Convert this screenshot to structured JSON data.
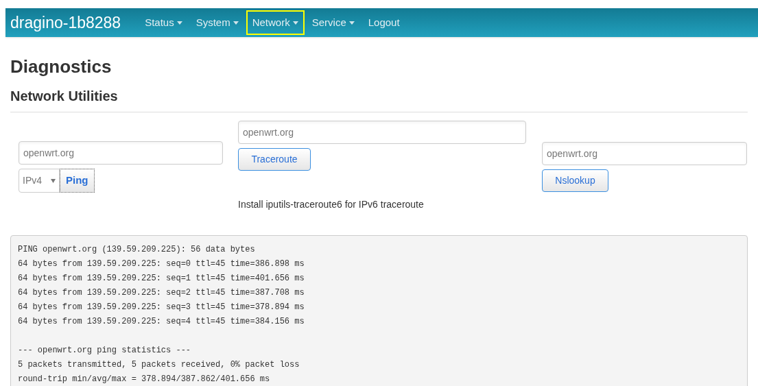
{
  "navbar": {
    "brand": "dragino-1b8288",
    "items": [
      {
        "label": "Status",
        "dropdown": true,
        "selected": false
      },
      {
        "label": "System",
        "dropdown": true,
        "selected": false
      },
      {
        "label": "Network",
        "dropdown": true,
        "selected": true
      },
      {
        "label": "Service",
        "dropdown": true,
        "selected": false
      },
      {
        "label": "Logout",
        "dropdown": false,
        "selected": false
      }
    ]
  },
  "page_title": "Diagnostics",
  "section_title": "Network Utilities",
  "ping": {
    "value": "openwrt.org",
    "protocol": "IPv4",
    "button": "Ping",
    "focused": true
  },
  "traceroute": {
    "value": "openwrt.org",
    "button": "Traceroute",
    "note": "Install iputils-traceroute6 for IPv6 traceroute"
  },
  "nslookup": {
    "value": "openwrt.org",
    "button": "Nslookup"
  },
  "output": {
    "blocks": [
      {
        "lines": [
          "PING openwrt.org (139.59.209.225): 56 data bytes",
          "64 bytes from 139.59.209.225: seq=0 ttl=45 time=386.898 ms",
          "64 bytes from 139.59.209.225: seq=1 ttl=45 time=401.656 ms",
          "64 bytes from 139.59.209.225: seq=2 ttl=45 time=387.708 ms",
          "64 bytes from 139.59.209.225: seq=3 ttl=45 time=378.894 ms",
          "64 bytes from 139.59.209.225: seq=4 ttl=45 time=384.156 ms"
        ]
      },
      {
        "lines": [
          "--- openwrt.org ping statistics ---",
          "5 packets transmitted, 5 packets received, 0% packet loss",
          "round-trip min/avg/max = 378.894/387.862/401.656 ms"
        ]
      }
    ]
  }
}
